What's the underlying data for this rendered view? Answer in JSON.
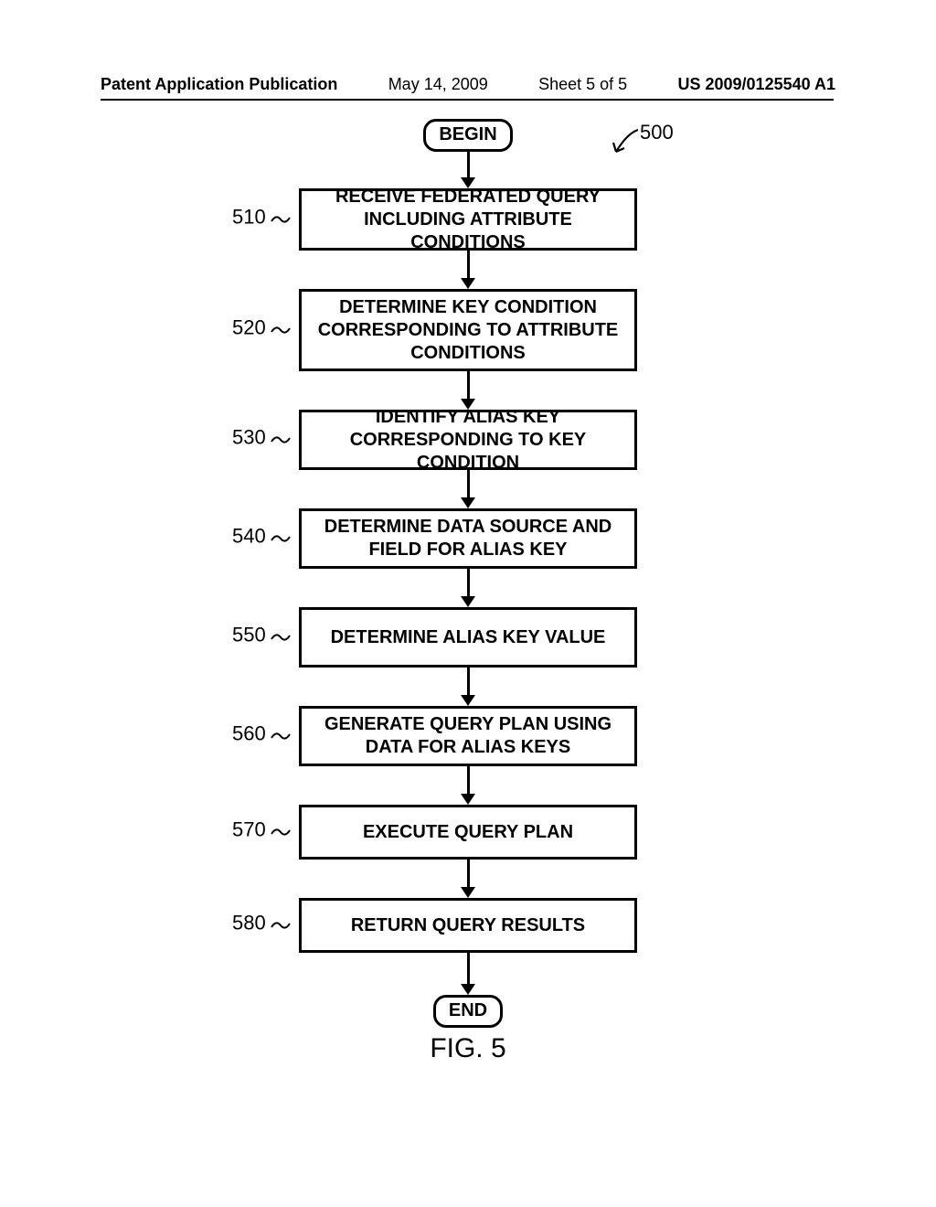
{
  "header": {
    "publication": "Patent Application Publication",
    "date": "May 14, 2009",
    "sheet": "Sheet 5 of 5",
    "docnum": "US 2009/0125540 A1"
  },
  "diagram": {
    "ref": "500",
    "begin": "BEGIN",
    "end": "END",
    "caption": "FIG. 5",
    "steps": [
      {
        "num": "510",
        "text": "RECEIVE FEDERATED QUERY INCLUDING ATTRIBUTE CONDITIONS"
      },
      {
        "num": "520",
        "text": "DETERMINE KEY CONDITION CORRESPONDING TO ATTRIBUTE CONDITIONS"
      },
      {
        "num": "530",
        "text": "IDENTIFY ALIAS KEY CORRESPONDING TO KEY CONDITION"
      },
      {
        "num": "540",
        "text": "DETERMINE DATA SOURCE AND FIELD FOR ALIAS KEY"
      },
      {
        "num": "550",
        "text": "DETERMINE ALIAS KEY VALUE"
      },
      {
        "num": "560",
        "text": "GENERATE QUERY PLAN USING DATA FOR ALIAS KEYS"
      },
      {
        "num": "570",
        "text": "EXECUTE QUERY PLAN"
      },
      {
        "num": "580",
        "text": "RETURN QUERY RESULTS"
      }
    ]
  }
}
